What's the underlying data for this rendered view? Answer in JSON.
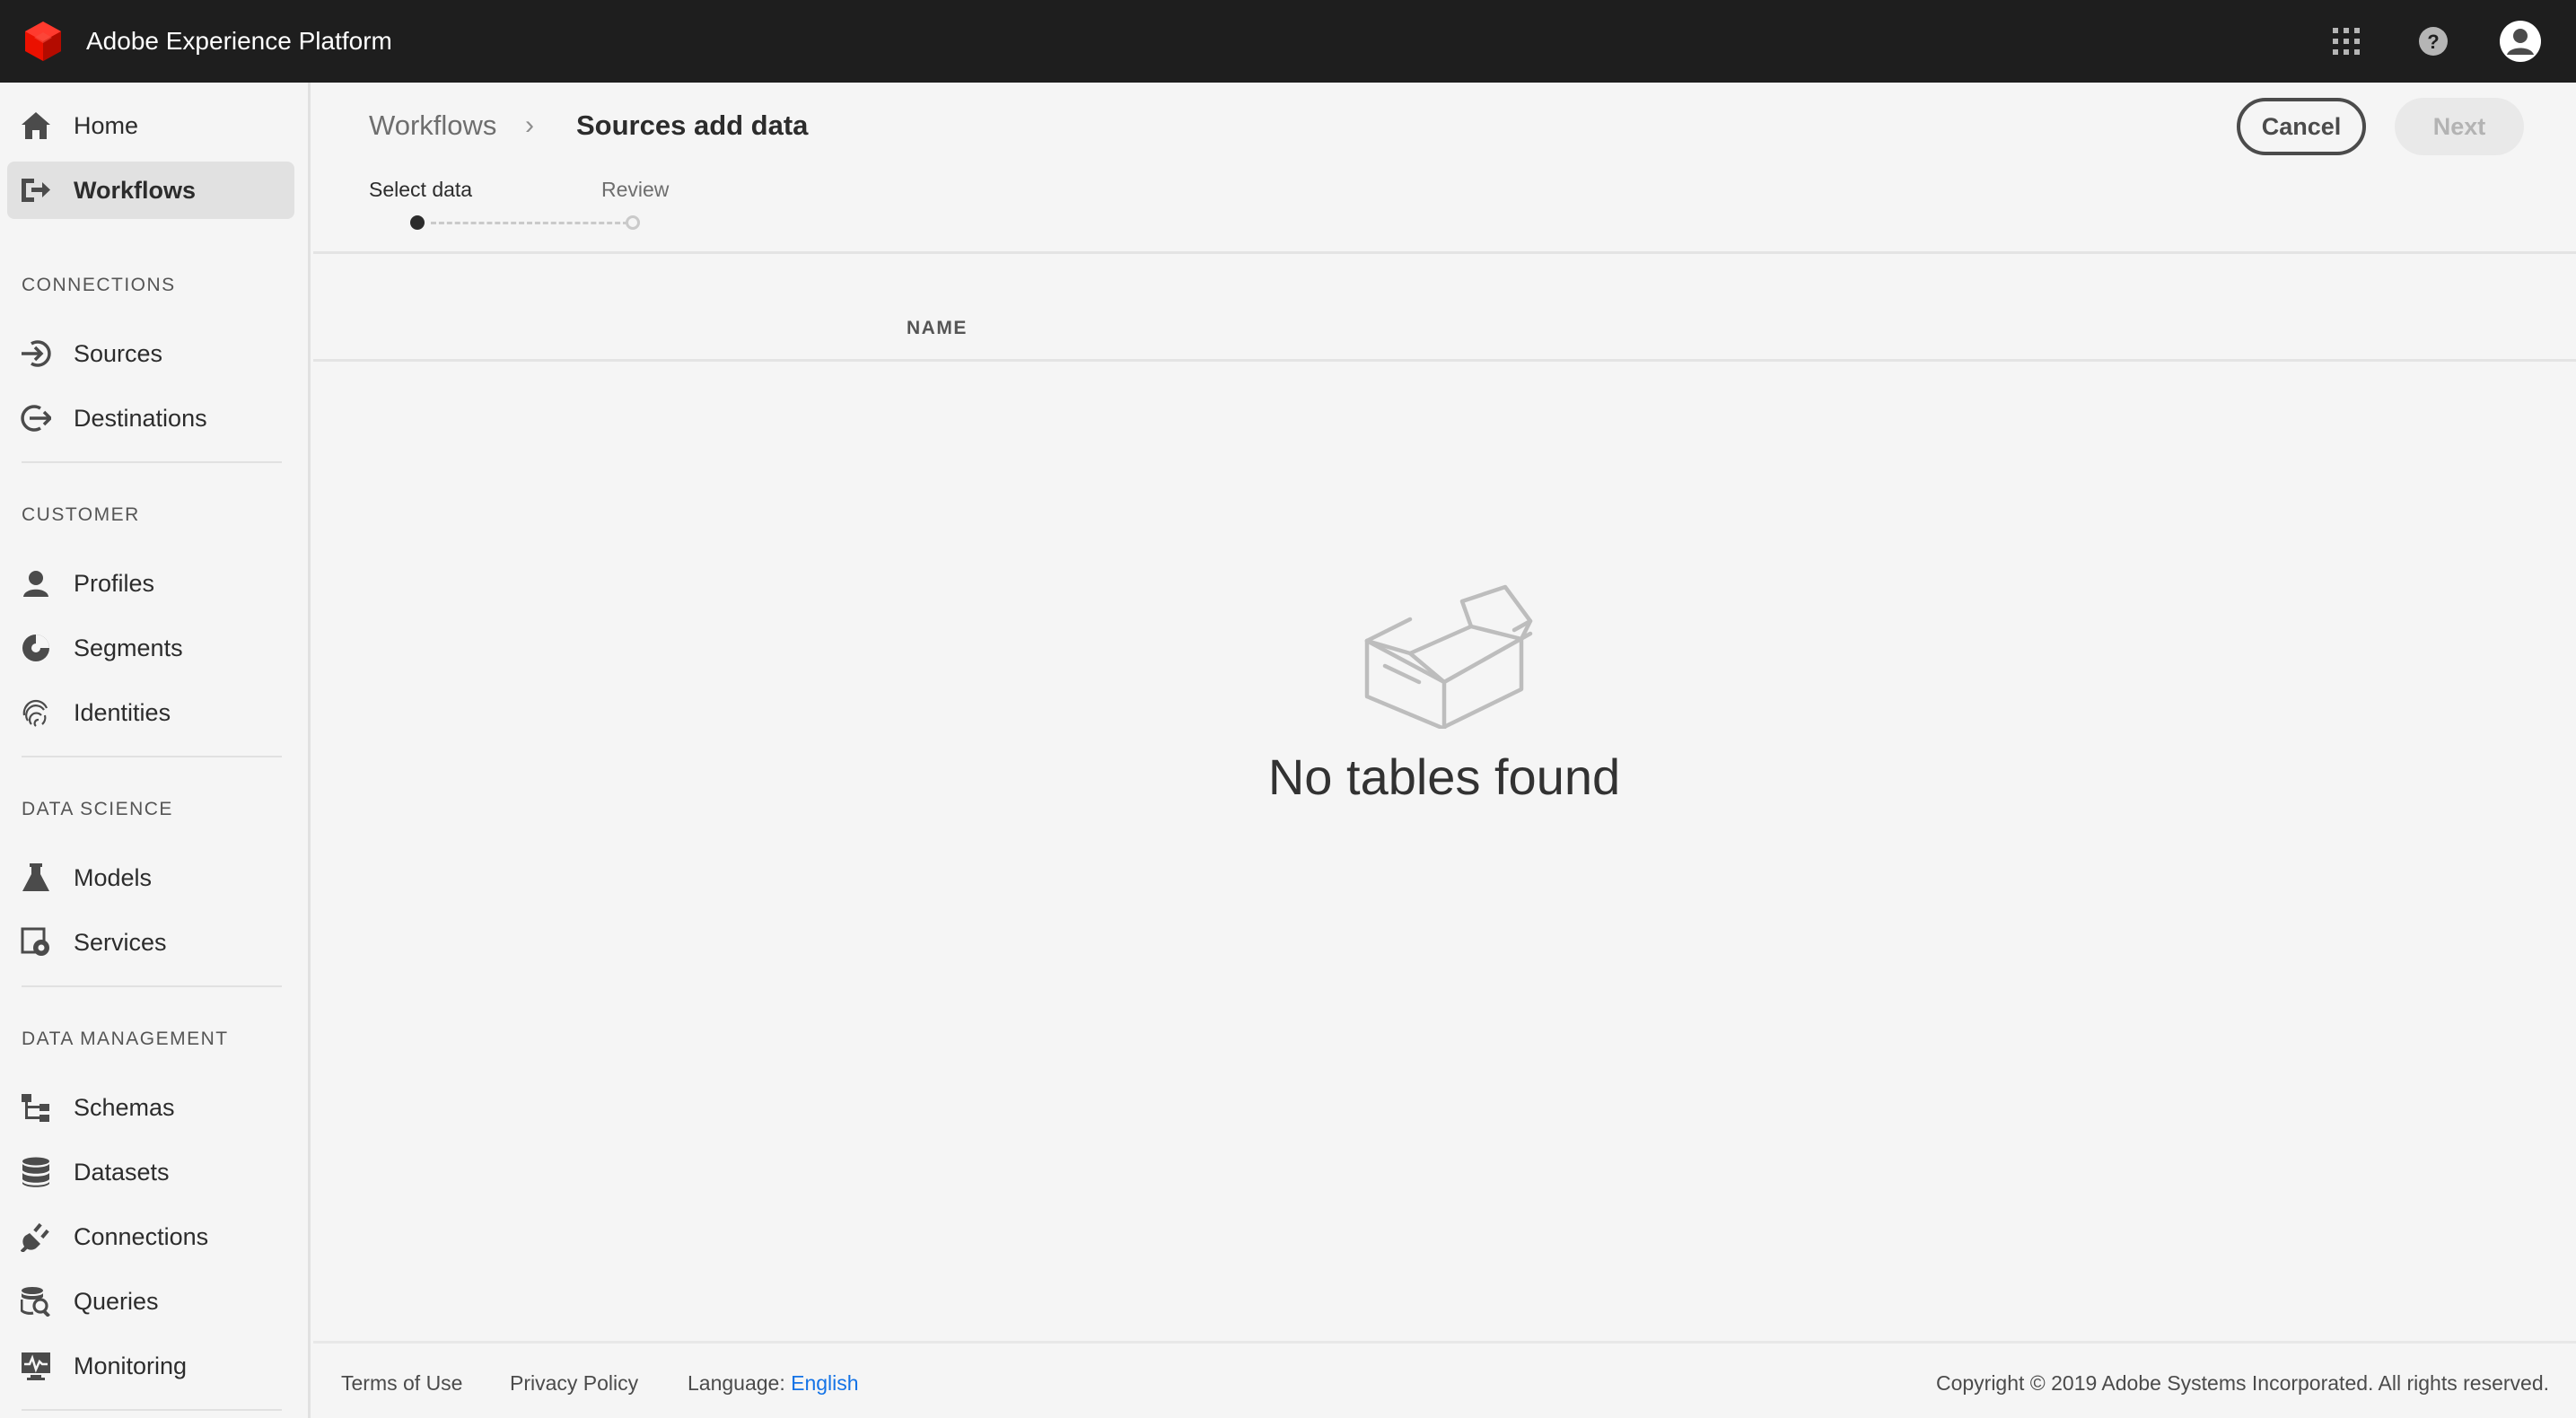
{
  "app": {
    "title": "Adobe Experience Platform",
    "brand_color": "#eb1000"
  },
  "topbar": {
    "icons": [
      "apps-grid-icon",
      "help-icon",
      "user-avatar-icon"
    ]
  },
  "sidebar": {
    "top_items": [
      {
        "label": "Home",
        "icon": "home-icon"
      },
      {
        "label": "Workflows",
        "icon": "workflows-icon",
        "active": true
      }
    ],
    "sections": [
      {
        "heading": "CONNECTIONS",
        "items": [
          {
            "label": "Sources",
            "icon": "sources-icon"
          },
          {
            "label": "Destinations",
            "icon": "destinations-icon"
          }
        ]
      },
      {
        "heading": "CUSTOMER",
        "items": [
          {
            "label": "Profiles",
            "icon": "profile-icon"
          },
          {
            "label": "Segments",
            "icon": "segments-icon"
          },
          {
            "label": "Identities",
            "icon": "fingerprint-icon"
          }
        ]
      },
      {
        "heading": "DATA SCIENCE",
        "items": [
          {
            "label": "Models",
            "icon": "flask-icon"
          },
          {
            "label": "Services",
            "icon": "services-gear-icon"
          }
        ]
      },
      {
        "heading": "DATA MANAGEMENT",
        "items": [
          {
            "label": "Schemas",
            "icon": "schema-icon"
          },
          {
            "label": "Datasets",
            "icon": "database-icon"
          },
          {
            "label": "Connections",
            "icon": "plug-icon"
          },
          {
            "label": "Queries",
            "icon": "query-icon"
          },
          {
            "label": "Monitoring",
            "icon": "monitoring-icon"
          }
        ]
      }
    ]
  },
  "main": {
    "breadcrumb": {
      "root": "Workflows",
      "separator": "›",
      "current": "Sources add data"
    },
    "actions": {
      "cancel": "Cancel",
      "next": "Next"
    },
    "steps": [
      {
        "label": "Select data",
        "state": "active"
      },
      {
        "label": "Review",
        "state": "inactive"
      }
    ],
    "table": {
      "column_name": "NAME"
    },
    "empty_state": {
      "icon": "empty-box-icon",
      "message": "No tables found"
    }
  },
  "footer": {
    "terms": "Terms of Use",
    "privacy": "Privacy Policy",
    "language_label": "Language:",
    "language_value": "English",
    "copyright": "Copyright © 2019 Adobe Systems Incorporated. All rights reserved."
  }
}
